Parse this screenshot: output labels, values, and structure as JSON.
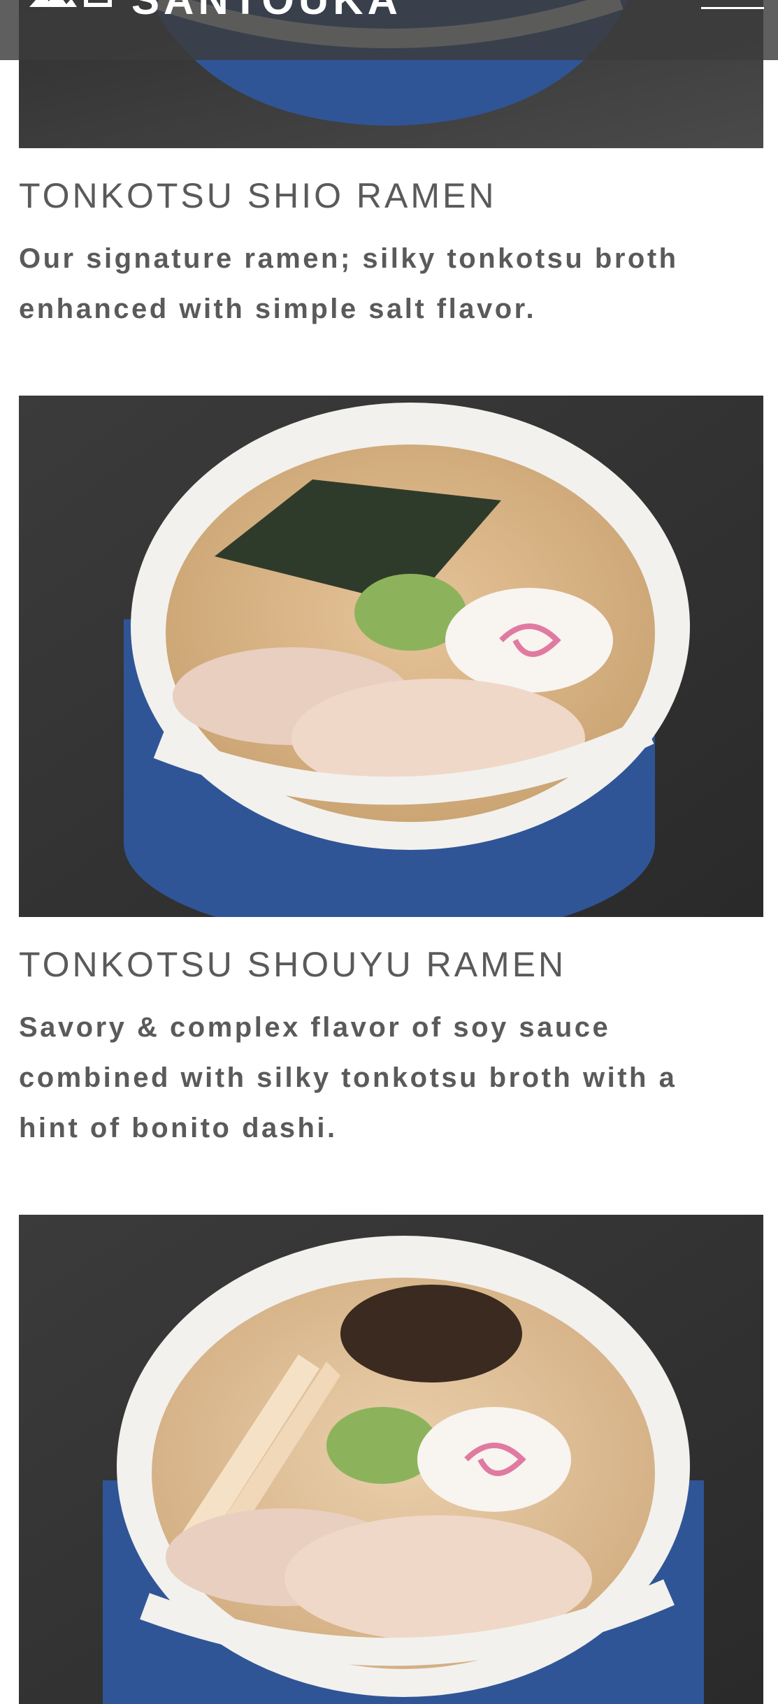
{
  "header": {
    "brand": "SANTOUKA",
    "menu_icon": "hamburger-menu-icon"
  },
  "menu_items": [
    {
      "title": "TONKOTSU SHIO RAMEN",
      "description": "Our signature ramen; silky tonkotsu broth enhanced with simple salt flavor."
    },
    {
      "title": "TONKOTSU SHOUYU RAMEN",
      "description": "Savory & complex flavor of soy sauce combined with silky tonkotsu broth with a hint of bonito dashi."
    }
  ],
  "colors": {
    "header_bg": "#3c3c3c",
    "text": "#5a5a5a",
    "bowl_blue": "#2f5596",
    "table_dark": "#3a3a3a"
  }
}
